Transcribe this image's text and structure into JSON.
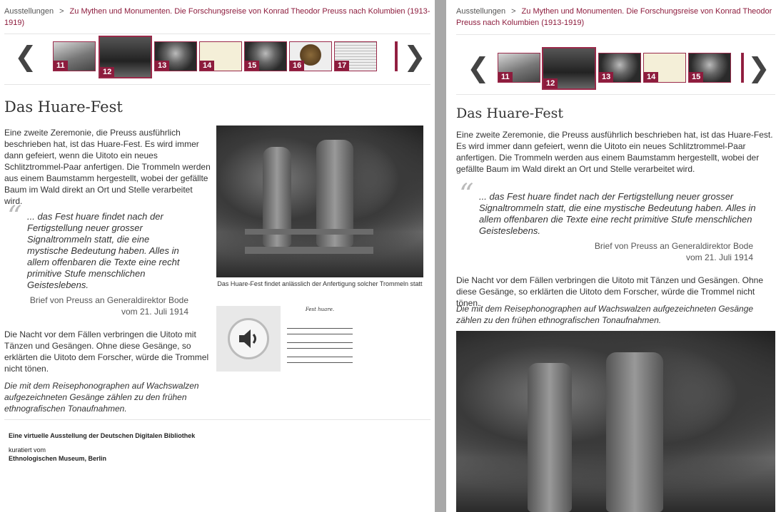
{
  "breadcrumb": {
    "root": "Ausstellungen",
    "separator": ">",
    "current": "Zu Mythen und Monumenten. Die Forschungsreise von Konrad Theodor Preuss nach Kolumbien (1913-1919)"
  },
  "gallery": {
    "prev_icon": "chevron-left-icon",
    "next_icon": "chevron-right-icon",
    "prev_glyph": "❮",
    "next_glyph": "❯",
    "active": "12",
    "thumbs_left": [
      "11",
      "12",
      "13",
      "14",
      "15",
      "16",
      "17"
    ],
    "thumbs_right": [
      "11",
      "12",
      "13",
      "14",
      "15"
    ]
  },
  "article": {
    "title": "Das Huare-Fest",
    "intro": "Eine zweite Zeremonie, die Preuss ausführlich beschrieben hat, ist das Huare-Fest. Es wird immer dann gefeiert, wenn die Uitoto ein neues Schlitztrommel-Paar anfertigen. Die Trommeln werden aus einem Baumstamm hergestellt, wobei der gefällte Baum im Wald direkt an Ort und Stelle verarbeitet wird.",
    "quote_mark": "“",
    "quote": "... das Fest huare findet nach der Fertigstellung neuer grosser Signaltrommeln statt, die eine mystische Bedeutung haben. Alles in allem offenbaren die Texte eine recht primitive Stufe menschlichen Geisteslebens.",
    "quote_source_line1": "Brief von Preuss an Generaldirektor Bode",
    "quote_source_line2": "vom 21. Juli 1914",
    "paragraph2": "Die Nacht vor dem Fällen verbringen die Uitoto mit Tänzen und Gesängen. Ohne diese Gesänge, so erklärten die Uitoto dem Forscher, würde die Trommel nicht tönen.",
    "paragraph3": "Die mit dem Reisephonographen auf Wachswalzen aufgezeichneten Gesänge zählen zu den frühen ethnografischen Tonaufnahmen.",
    "image_caption": "Das Huare-Fest findet anlässlich der Anfertigung solcher Trommeln statt",
    "audio_icon": "speaker-icon",
    "score_title": "Fest huare."
  },
  "footer": {
    "line1": "Eine virtuelle Ausstellung der Deutschen Digitalen Bibliothek",
    "line2": "kuratiert vom",
    "line3": "Ethnologischen Museum, Berlin"
  }
}
